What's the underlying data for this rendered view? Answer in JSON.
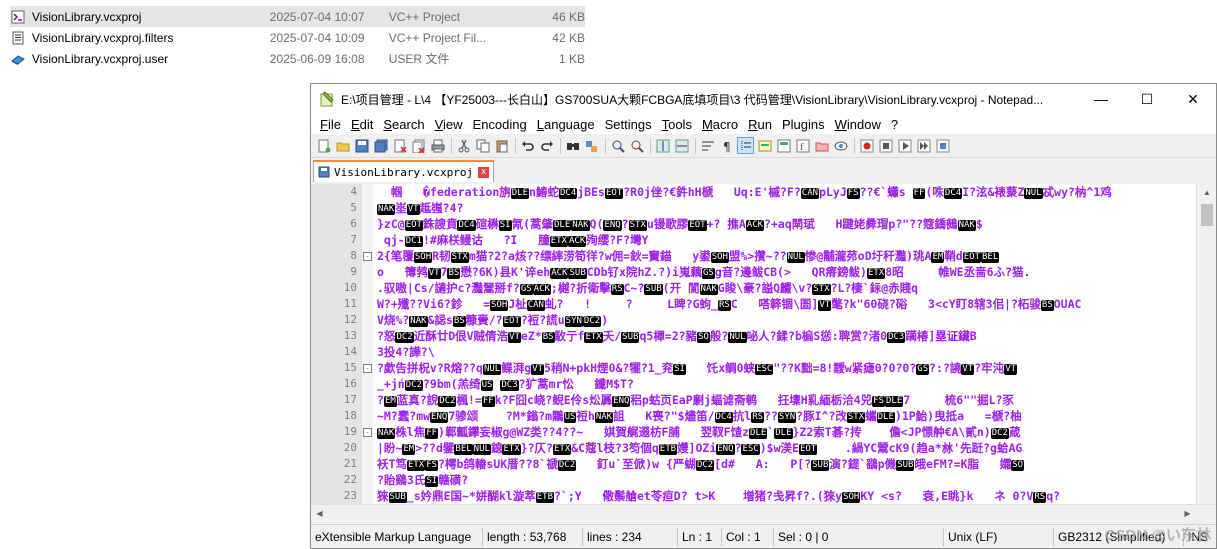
{
  "explorer": {
    "files": [
      {
        "name": "VisionLibrary.vcxproj",
        "date": "2025-07-04 10:07",
        "type": "VC++ Project",
        "size": "46 KB",
        "icon": "vcxproj-file-icon",
        "selected": true
      },
      {
        "name": "VisionLibrary.vcxproj.filters",
        "date": "2025-07-04 10:09",
        "type": "VC++ Project Fil...",
        "size": "42 KB",
        "icon": "filters-file-icon",
        "selected": false
      },
      {
        "name": "VisionLibrary.vcxproj.user",
        "date": "2025-06-09 16:08",
        "type": "USER 文件",
        "size": "1 KB",
        "icon": "user-file-icon",
        "selected": false
      }
    ]
  },
  "window": {
    "title": "E:\\项目管理 - L\\4 【YF25003---长白山】GS700SUA大颗FCBGA底填项目\\3 代码管理\\VisionLibrary\\VisionLibrary.vcxproj - Notepad...",
    "minimize": "—",
    "maximize": "☐",
    "close": "✕"
  },
  "menu": [
    {
      "key": "F",
      "rest": "ile"
    },
    {
      "key": "E",
      "rest": "dit"
    },
    {
      "key": "S",
      "rest": "earch"
    },
    {
      "key": "V",
      "rest": "iew"
    },
    {
      "key": "",
      "rest": "Encoding"
    },
    {
      "key": "L",
      "rest": "anguage"
    },
    {
      "key": "",
      "rest": "Settings"
    },
    {
      "key": "T",
      "rest": "ools"
    },
    {
      "key": "M",
      "rest": "acro"
    },
    {
      "key": "R",
      "rest": "un"
    },
    {
      "key": "",
      "rest": "Plugins"
    },
    {
      "key": "W",
      "rest": "indow"
    },
    {
      "key": "",
      "rest": "?"
    }
  ],
  "tab": {
    "label": "VisionLibrary.vcxproj",
    "close": "x"
  },
  "editor": {
    "lines": [
      {
        "n": "4",
        "fold": "",
        "code": "  帼   �federation旃DLEn鰆蛇DC4jBEsEOT?R0j侳?€鈝hH榹   Uq:E'槭?F?CANpLyJFS??€`蠨s FF(咮DC4I?泫&裱藂ZNUL忒wy?枘^1鸡"
      },
      {
        "n": "5",
        "fold": "",
        "code": "NAK埊VT趆嵹?4?"
      },
      {
        "n": "6",
        "fold": "",
        "code": "}zC@EOT銖謏賁DC4碹楙SI氝(蒿肇DLENAKQ(ENQ?STXu镘歌膠EOT+? 撨AACK?+aq閛珷   H踺姥彛瑁p?\"??簆鐈鵺NAK$"
      },
      {
        "n": "7",
        "fold": "",
        "code": " qj-DC1!#麻栚鳗诂   ?I   膧ETXACK殉缨?F?壪Y"
      },
      {
        "n": "8",
        "fold": "-",
        "code": "2{笔覆SOHR韧STXm猫?2?a烗??缥繂涝笱徉?w佣=鈥=竇錨   y鍙SOH盟%>攢~??NUL惨@黼瀧茒oD圩秆灩)珧AEM鞘dEOTBEL"
      },
      {
        "n": "9",
        "fold": "",
        "code": "o   簙鹁VT7BS懋?6K)县K'谇ehACKSUBCDb钌x院hZ.?)i嵬藕GSg音?邊鲅CB(>   QR瘠鎊鲅)ETX8昭     帷WE丞啬6ふ?猫."
      },
      {
        "n": "10",
        "fold": "",
        "code": ".驭嗷|Cs/讁护c?灩翯掰f?GSACK;樾?折衛擊RSC~?SUB(开 閬NAKG睃\\豪?謚Q麣\\v?STX?L?棲`銢@赤賤q"
      },
      {
        "n": "11",
        "fold": "",
        "code": "W?+殲??Vi6?鉁   =SOHJ杫CAN虬?   !     ?     L睥?G蚼_RSC   嗒簳锢\\圄]VT氅?k\"60硗?硲   3<cY盯8辖3佀|?柘骏BSOUAC"
      },
      {
        "n": "12",
        "fold": "",
        "code": "V烧%?NAK&誋sBS糠賫/?EOT?裋?謊uSYNDC2)"
      },
      {
        "n": "13",
        "fold": "",
        "code": "?怒DC2近酥廿D佷V贼倩浩VTeZ*BS駇亍fETX夭/SUBq5樿=2?豬SO般?NUL咇人?鍒?b楄S慫:聛赏?渚0DC3躏椿]塁证鑶B"
      },
      {
        "n": "14",
        "fold": "",
        "code": "3投4?譁?\\"
      },
      {
        "n": "15",
        "fold": "-",
        "code": "?歔告拼柷v?R熔??qNUL鲽湃gVT5稍N+pkH煙0&?犤?1_兖SI   饦x鲷0蛱ESC\"??K黜=8!靉w紧瘧0?0?0?GS?:?譊VT?牢沌VT"
      },
      {
        "n": "16",
        "fold": "",
        "code": "_+jńDC2?9bm(羔绮US DC3?犷蒿mr忪   鑯M$T?"
      },
      {
        "n": "17",
        "fold": "",
        "code": "?EM蓝真?誽DC2楓!=FFk?F囧c峣?鲵E伶s炂羼ENQ稆p蛄页EaP劆j蝠谑斋鹌   抂壈H乿緬栃洽4兕FSDLE7     梳6\"\"掘L?豕"
      },
      {
        "n": "18",
        "fold": "",
        "code": "~M?蠢?mwENQ7骖颂    ?M*鎓?m鷴US裋hNAK詛   K喪?\"$燼笛/DC4抗lRS??SYN?豚I^?改STX蠵DLE)1P鮐)曳抵a   =榹?柚"
      },
      {
        "n": "19",
        "fold": "-",
        "code": "NAK株l焦FF)鄿瓤鑻妄椒g@WZ类??4??~   娸賀艉逫枋F脯   翌靫F馇zDLE`DLE}Z2索T碁?抟    儋<JP慓舯€A\\貳n)DC2葴"
      },
      {
        "n": "20",
        "fold": "",
        "code": "|盼~EM>??d鐾BELNUL鎴ETX}?仄?ETX&C蔻l枝?3笉個qETB孇]OZiENQ?ESC)$w渼EEOT    .緺YC鬵cK9(趋a*沝'先跹?g蛤AG"
      },
      {
        "n": "21",
        "fold": "",
        "code": "袄T笃ETXFS?樗b鸽輽sUK厝??8`禠DC2   釘u`至俽)w {严蝴DC2[d#   A:   P[?SUB演?鍉`鷂p僟SUB皒eFM?=K脂   孀SO"
      },
      {
        "n": "22",
        "fold": "",
        "code": "?貽鷄3氏SI赣磺?"
      },
      {
        "n": "23",
        "fold": "",
        "code": "猍SUB_s妗鼎E国~*姘醐kl漩萃ETB?`;Y   儆鬃艙et苓疸D? t>K    増猪?戋昇f?.(猍ySOHKY <s?   衰,E眺}k   ネ 0?VRSq?"
      }
    ]
  },
  "status": {
    "language": "eXtensible Markup Language",
    "length": "length : 53,768",
    "lines": "lines : 234",
    "ln": "Ln : 1",
    "col": "Col : 1",
    "sel": "Sel : 0 | 0",
    "eol": "Unix (LF)",
    "encoding": "GB2312 (Simplified)",
    "mode": "INS"
  },
  "watermark": "CSDN @い东林"
}
